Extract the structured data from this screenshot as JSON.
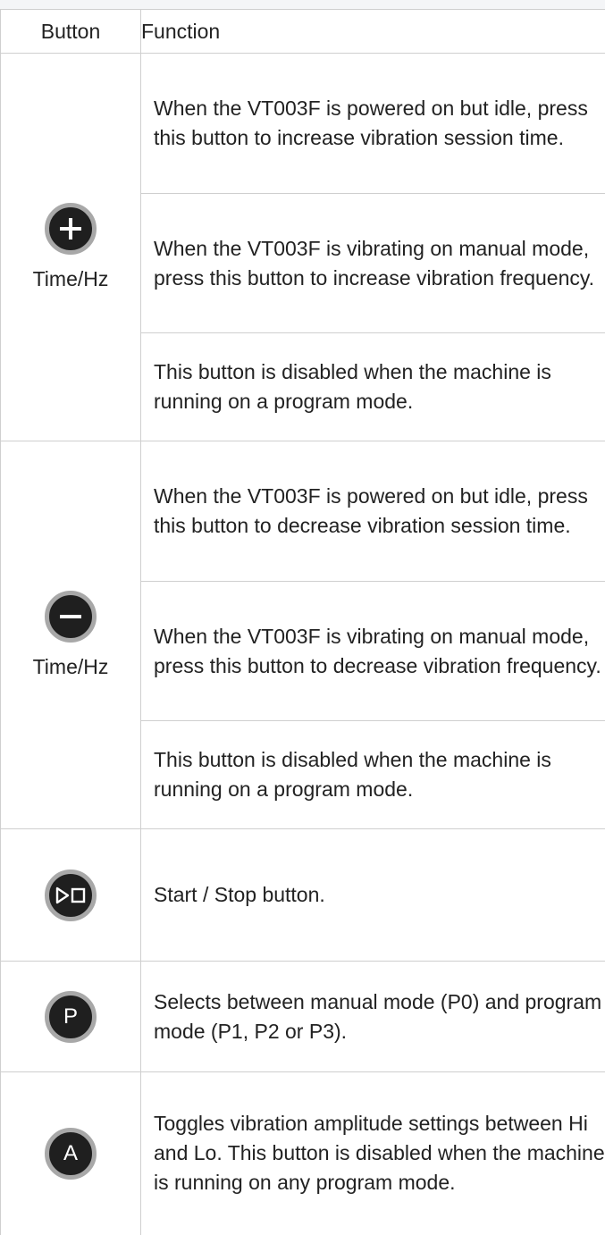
{
  "header": {
    "button": "Button",
    "function": "Function"
  },
  "groups": [
    {
      "icon": "plus-icon",
      "label": "Time/Hz",
      "rows": [
        "When the VT003F is powered on but idle, press this button to increase vibration session time.",
        "When the VT003F is vibrating on manual mode, press this button to increase vibration frequency.",
        "This button is disabled when the machine is running on a program mode."
      ]
    },
    {
      "icon": "minus-icon",
      "label": "Time/Hz",
      "rows": [
        "When the VT003F is powered on but idle, press this button to decrease vibration session time.",
        "When the VT003F is vibrating on manual mode, press this button to decrease vibration frequency.",
        "This button is disabled when the machine is running on a program mode."
      ]
    },
    {
      "icon": "play-stop-icon",
      "rows": [
        "Start / Stop button."
      ]
    },
    {
      "icon": "p-letter-icon",
      "icon_letter": "P",
      "rows": [
        "Selects between manual mode (P0) and program mode (P1, P2 or P3)."
      ]
    },
    {
      "icon": "a-letter-icon",
      "icon_letter": "A",
      "rows": [
        "Toggles vibration amplitude settings between Hi and Lo. This button is disabled when the machine is running on any program mode."
      ]
    }
  ]
}
